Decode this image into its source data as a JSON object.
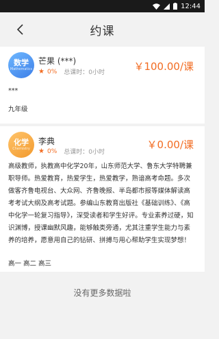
{
  "status_bar": {
    "time": "12:44"
  },
  "nav": {
    "title": "约课"
  },
  "teachers": [
    {
      "avatar_subject": "数学",
      "avatar_english": "Mathematics",
      "name": "芒果 (***)",
      "rating_pct": "0%",
      "hours": "总课时：0小时",
      "price": "￥100.00/课",
      "intro": "***",
      "grades": "九年级"
    },
    {
      "avatar_subject": "化学",
      "avatar_english": "Chemistry",
      "name": "李典",
      "rating_pct": "0%",
      "hours": "总课时：0小时",
      "price": "￥0.00/课",
      "intro": "高级教师，执教高中化学20年，山东师范大学、鲁东大学特聘兼职导师。热爱教育，热爱学生，热爱教学，熟谙高考命题。多次做客齐鲁电视台、大众网、齐鲁晚报、半岛都市报等媒体解读高考考试大纲及高考试题。参编山东教育出版社《基础训练》、《高中化学一轮复习指导》，深受读者和学生好评。专业素养过硬，知识渊博，授课幽默风趣，能够触类旁通，尤其注重学生能力与素养的培养，愿意用自己的钻研、拼搏与用心帮助学生实现梦想！",
      "grades": "高一 高二 高三"
    }
  ],
  "footer": {
    "no_more": "没有更多数据啦"
  }
}
